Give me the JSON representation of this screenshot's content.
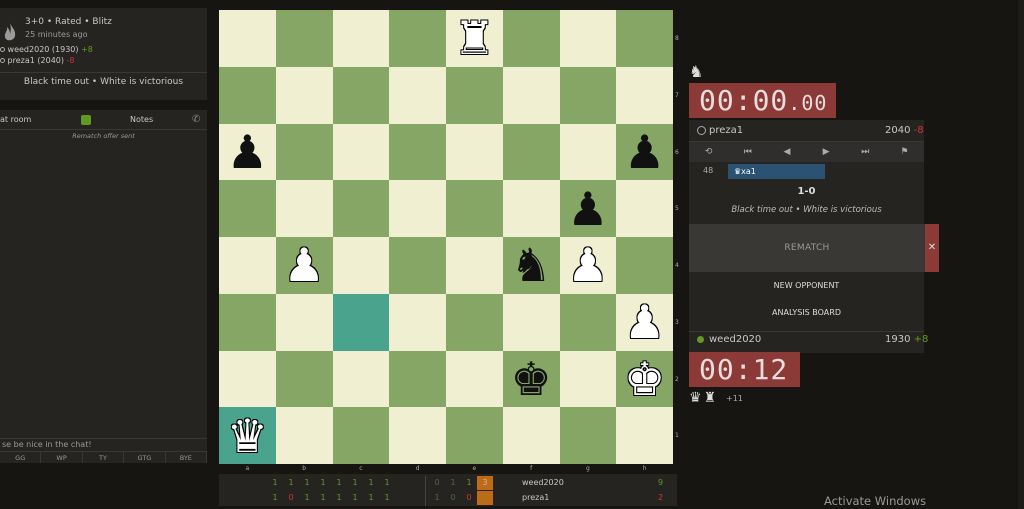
{
  "game": {
    "mode": "3+0 • Rated • Blitz",
    "when": "25 minutes ago"
  },
  "left_players": [
    {
      "name": "weed2020 (1930)",
      "diff": "+8",
      "diff_color": "#629924"
    },
    {
      "name": "preza1 (2040)",
      "diff": "-8",
      "diff_color": "#cc3333"
    }
  ],
  "left_result": "Black time out • White is victorious",
  "chat": {
    "tab_room": "at room",
    "tab_notes": "Notes",
    "message": "Rematch offer sent",
    "input_placeholder": "se be nice in the chat!",
    "presets": [
      "GG",
      "WP",
      "TY",
      "GTG",
      "BYE"
    ]
  },
  "board": {
    "files": [
      "a",
      "b",
      "c",
      "d",
      "e",
      "f",
      "g",
      "h"
    ],
    "ranks": [
      "8",
      "7",
      "6",
      "5",
      "4",
      "3",
      "2",
      "1"
    ],
    "pieces": [
      {
        "sq": "e8",
        "glyph": "♜",
        "color": "w"
      },
      {
        "sq": "a6",
        "glyph": "♟",
        "color": "b"
      },
      {
        "sq": "h6",
        "glyph": "♟",
        "color": "b"
      },
      {
        "sq": "g5",
        "glyph": "♟",
        "color": "b"
      },
      {
        "sq": "b4",
        "glyph": "♟",
        "color": "w"
      },
      {
        "sq": "f4",
        "glyph": "♞",
        "color": "b"
      },
      {
        "sq": "g4",
        "glyph": "♟",
        "color": "w"
      },
      {
        "sq": "h3",
        "glyph": "♟",
        "color": "w"
      },
      {
        "sq": "f2",
        "glyph": "♚",
        "color": "b"
      },
      {
        "sq": "h2",
        "glyph": "♚",
        "color": "w"
      },
      {
        "sq": "a1",
        "glyph": "♛",
        "color": "w"
      }
    ],
    "highlight": [
      "c3",
      "a1"
    ]
  },
  "crosstable": {
    "row1": [
      "1",
      "1",
      "1",
      "1",
      "1",
      "1",
      "1",
      "1",
      "0",
      "1",
      "1",
      "3"
    ],
    "row2": [
      "1",
      "0",
      "1",
      "1",
      "1",
      "1",
      "1",
      "1",
      "1",
      "0",
      "0",
      "1"
    ],
    "player1": "weed2020",
    "score1": "9",
    "player2": "preza1",
    "score2": "2"
  },
  "top_clock": {
    "main": "00:00",
    "tenths": ".00"
  },
  "top_player": {
    "name": "preza1",
    "rating": "2040",
    "diff": "-8"
  },
  "controls": [
    "⟲",
    "⏮",
    "◀",
    "▶",
    "⏭",
    "⚑"
  ],
  "moves": {
    "number": "48",
    "move": "♛xa1"
  },
  "result": {
    "score": "1-0",
    "text": "Black time out • White is victorious"
  },
  "buttons": {
    "rematch": "REMATCH",
    "rematch_decline": "✕",
    "new_opponent": "NEW OPPONENT",
    "analysis_board": "ANALYSIS BOARD"
  },
  "bottom_player": {
    "name": "weed2020",
    "rating": "1930",
    "diff": "+8"
  },
  "bottom_clock": {
    "main": "00:12"
  },
  "captured_top": "♞",
  "captured_bottom": {
    "pieces": "♛♜",
    "advantage": "+11"
  },
  "watermark": "Activate Windows",
  "colors": {
    "accent_green": "#629924",
    "clock_red": "#8b3a37",
    "board_light": "#f0efd2",
    "board_dark": "#86a666",
    "last_move": "#4aa38c"
  }
}
